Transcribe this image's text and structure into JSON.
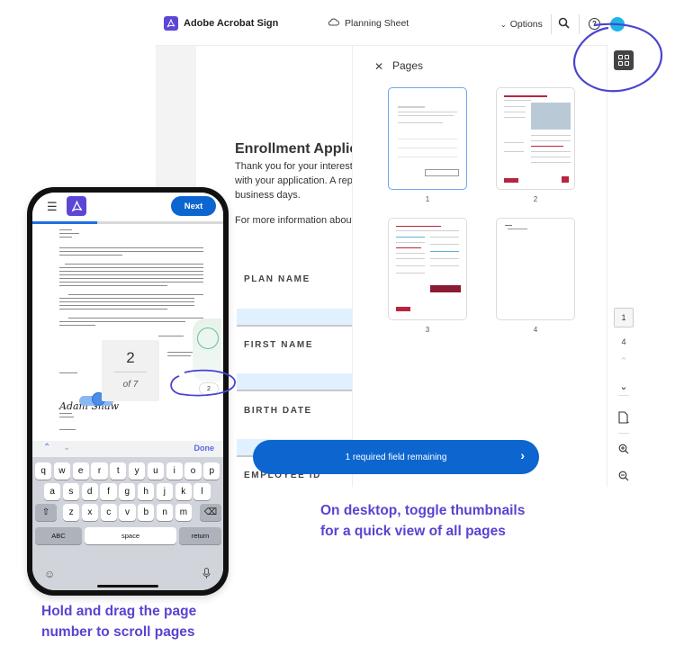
{
  "desktop": {
    "header": {
      "brand": "Adobe Acrobat Sign",
      "document_title": "Planning Sheet",
      "options_label": "Options",
      "icons": [
        "acrobat-logo-icon",
        "cloud-icon",
        "chevron-down-icon",
        "search-icon",
        "help-icon",
        "avatar"
      ]
    },
    "document": {
      "heading": "Enrollment Applica",
      "intro_lines": [
        "Thank you for your interest i",
        "with your application. A repr",
        "business days."
      ],
      "more_info": "For more information about Pl",
      "fields": [
        {
          "label": "PLAN NAME",
          "value": ""
        },
        {
          "label": "FIRST NAME",
          "value": ""
        },
        {
          "label": "BIRTH DATE",
          "value": ""
        },
        {
          "label": "EMPLOYEE ID",
          "value": ""
        }
      ]
    },
    "pages_panel": {
      "title": "Pages",
      "close_icon": "close-icon",
      "thumbnails": [
        {
          "number": "1",
          "selected": true
        },
        {
          "number": "2",
          "selected": false
        },
        {
          "number": "3",
          "selected": false
        },
        {
          "number": "4",
          "selected": false
        }
      ]
    },
    "right_rail": {
      "current_page": "1",
      "total_pages": "4",
      "icons": [
        "thumbnails-grid-icon",
        "chevron-up-icon",
        "chevron-down-icon",
        "page-view-icon",
        "zoom-in-icon",
        "zoom-out-icon"
      ]
    },
    "required_bar": {
      "label": "1 required field remaining",
      "icon": "chevron-right-icon"
    },
    "caption_lines": [
      "On desktop, toggle thumbnails",
      "for a quick view of all pages"
    ]
  },
  "mobile": {
    "next_label": "Next",
    "progress_percent": 34,
    "doc": {
      "signature": "Adam Shaw"
    },
    "scrubber": {
      "page": "2",
      "of_label": "of 7"
    },
    "page_pill": "2",
    "keyboard": {
      "done_label": "Done",
      "row1": [
        "q",
        "w",
        "e",
        "r",
        "t",
        "y",
        "u",
        "i",
        "o",
        "p"
      ],
      "row2": [
        "a",
        "s",
        "d",
        "f",
        "g",
        "h",
        "j",
        "k",
        "l"
      ],
      "row3": [
        "z",
        "x",
        "c",
        "v",
        "b",
        "n",
        "m"
      ],
      "abc_label": "ABC",
      "space_label": "space",
      "return_label": "return"
    },
    "caption_lines": [
      "Hold and drag the page",
      "number to scroll pages"
    ]
  },
  "colors": {
    "accent_blue": "#0d66d0",
    "brand_purple": "#5b47d6",
    "caption_purple": "#5a43d1",
    "field_fill": "#e1f0ff"
  }
}
